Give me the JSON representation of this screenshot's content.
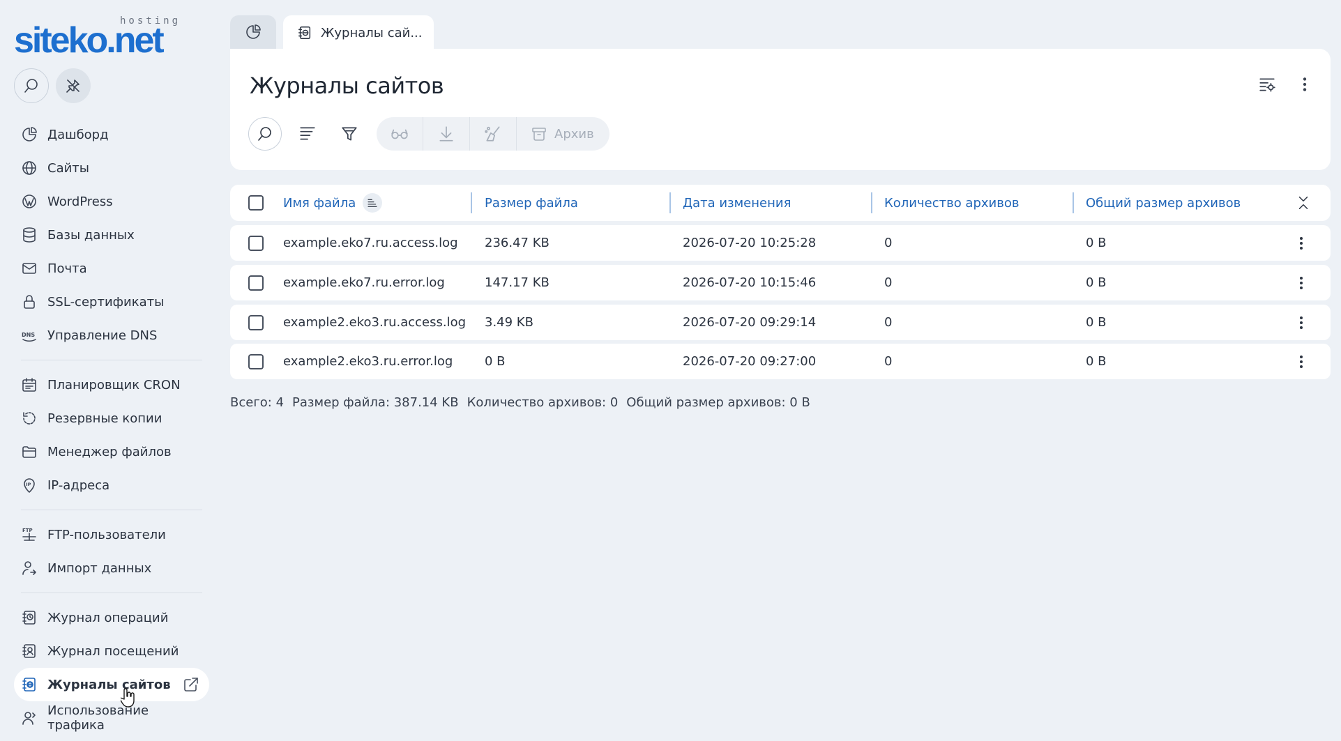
{
  "brand": {
    "name": "siteko.net",
    "sub": "hosting",
    "color": "#1d6fcf"
  },
  "sidebar": {
    "tools": [
      {
        "icon": "search-icon"
      },
      {
        "icon": "unpin-icon"
      }
    ],
    "groups": [
      [
        {
          "label": "Дашборд",
          "icon": "dashboard-pie-icon"
        },
        {
          "label": "Сайты",
          "icon": "globe-icon"
        },
        {
          "label": "WordPress",
          "icon": "wordpress-icon"
        },
        {
          "label": "Базы данных",
          "icon": "database-icon"
        },
        {
          "label": "Почта",
          "icon": "mail-icon"
        },
        {
          "label": "SSL-сертификаты",
          "icon": "lock-icon"
        },
        {
          "label": "Управление DNS",
          "icon": "dns-icon"
        }
      ],
      [
        {
          "label": "Планировщик CRON",
          "icon": "calendar-icon"
        },
        {
          "label": "Резервные копии",
          "icon": "backup-icon"
        },
        {
          "label": "Менеджер файлов",
          "icon": "folder-icon"
        },
        {
          "label": "IP-адреса",
          "icon": "ip-icon"
        }
      ],
      [
        {
          "label": "FTP-пользователи",
          "icon": "ftp-icon"
        },
        {
          "label": "Импорт данных",
          "icon": "import-icon"
        }
      ],
      [
        {
          "label": "Журнал операций",
          "icon": "operations-log-icon"
        },
        {
          "label": "Журнал посещений",
          "icon": "visits-log-icon"
        },
        {
          "label": "Журналы сайтов",
          "icon": "site-logs-icon",
          "active": true
        },
        {
          "label": "Использование трафика",
          "icon": "traffic-icon"
        }
      ]
    ]
  },
  "tabs": {
    "active_label": "Журналы сай..."
  },
  "page": {
    "title": "Журналы сайтов",
    "toolbar": {
      "archive_label": "Архив"
    }
  },
  "table": {
    "columns": [
      "Имя файла",
      "Размер файла",
      "Дата изменения",
      "Количество архивов",
      "Общий размер архивов"
    ],
    "rows": [
      [
        "example.eko7.ru.access.log",
        "236.47 KB",
        "2026-07-20 10:25:28",
        "0",
        "0 B"
      ],
      [
        "example.eko7.ru.error.log",
        "147.17 KB",
        "2026-07-20 10:15:46",
        "0",
        "0 B"
      ],
      [
        "example2.eko3.ru.access.log",
        "3.49 KB",
        "2026-07-20 09:29:14",
        "0",
        "0 B"
      ],
      [
        "example2.eko3.ru.error.log",
        "0 B",
        "2026-07-20 09:27:00",
        "0",
        "0 B"
      ]
    ]
  },
  "summary": {
    "total": "Всего: 4",
    "file_size": "Размер файла: 387.14 KB",
    "archive_count": "Количество архивов: 0",
    "archive_size": "Общий размер архивов: 0 B"
  }
}
